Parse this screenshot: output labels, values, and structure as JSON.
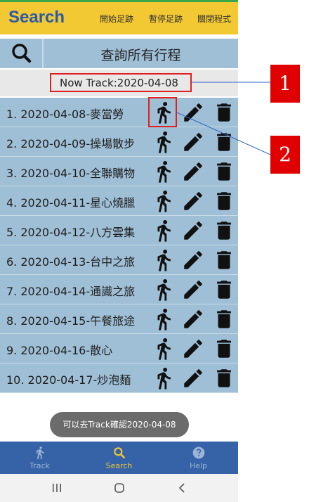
{
  "appbar": {
    "title": "Search",
    "menu": [
      "開始足跡",
      "暫停足跡",
      "關閉程式"
    ]
  },
  "search": {
    "label": "查詢所有行程",
    "icon": "search-icon"
  },
  "current_track": {
    "text": "Now Track:2020-04-08"
  },
  "trips": [
    {
      "label": "1. 2020-04-08-麥當勞"
    },
    {
      "label": "2. 2020-04-09-操場散步"
    },
    {
      "label": "3. 2020-04-10-全聯購物"
    },
    {
      "label": "4. 2020-04-11-星心燒臘"
    },
    {
      "label": "5. 2020-04-12-八方雲集"
    },
    {
      "label": "6. 2020-04-13-台中之旅"
    },
    {
      "label": "7. 2020-04-14-通識之旅"
    },
    {
      "label": "8. 2020-04-15-午餐旅途"
    },
    {
      "label": "9. 2020-04-16-散心"
    },
    {
      "label": "10. 2020-04-17-炒泡麵"
    }
  ],
  "trip_actions": [
    "run-icon",
    "edit-pencil-icon",
    "trash-icon"
  ],
  "toast": {
    "text": "可以去Track確認2020-04-08"
  },
  "bottom_nav": [
    {
      "label": "Track",
      "icon": "run-icon",
      "active": false
    },
    {
      "label": "Search",
      "icon": "search-icon",
      "active": true
    },
    {
      "label": "Help",
      "icon": "help-icon",
      "active": false
    }
  ],
  "system_nav": [
    "recents-icon",
    "home-icon",
    "back-icon"
  ],
  "callouts": [
    "1",
    "2"
  ],
  "colors": {
    "appbar": "#f2c833",
    "title": "#2c5aa8",
    "list_bg": "#9fbfd6",
    "bottom_nav": "#3663a8",
    "highlight": "#e02020",
    "callout": "#e00000"
  }
}
